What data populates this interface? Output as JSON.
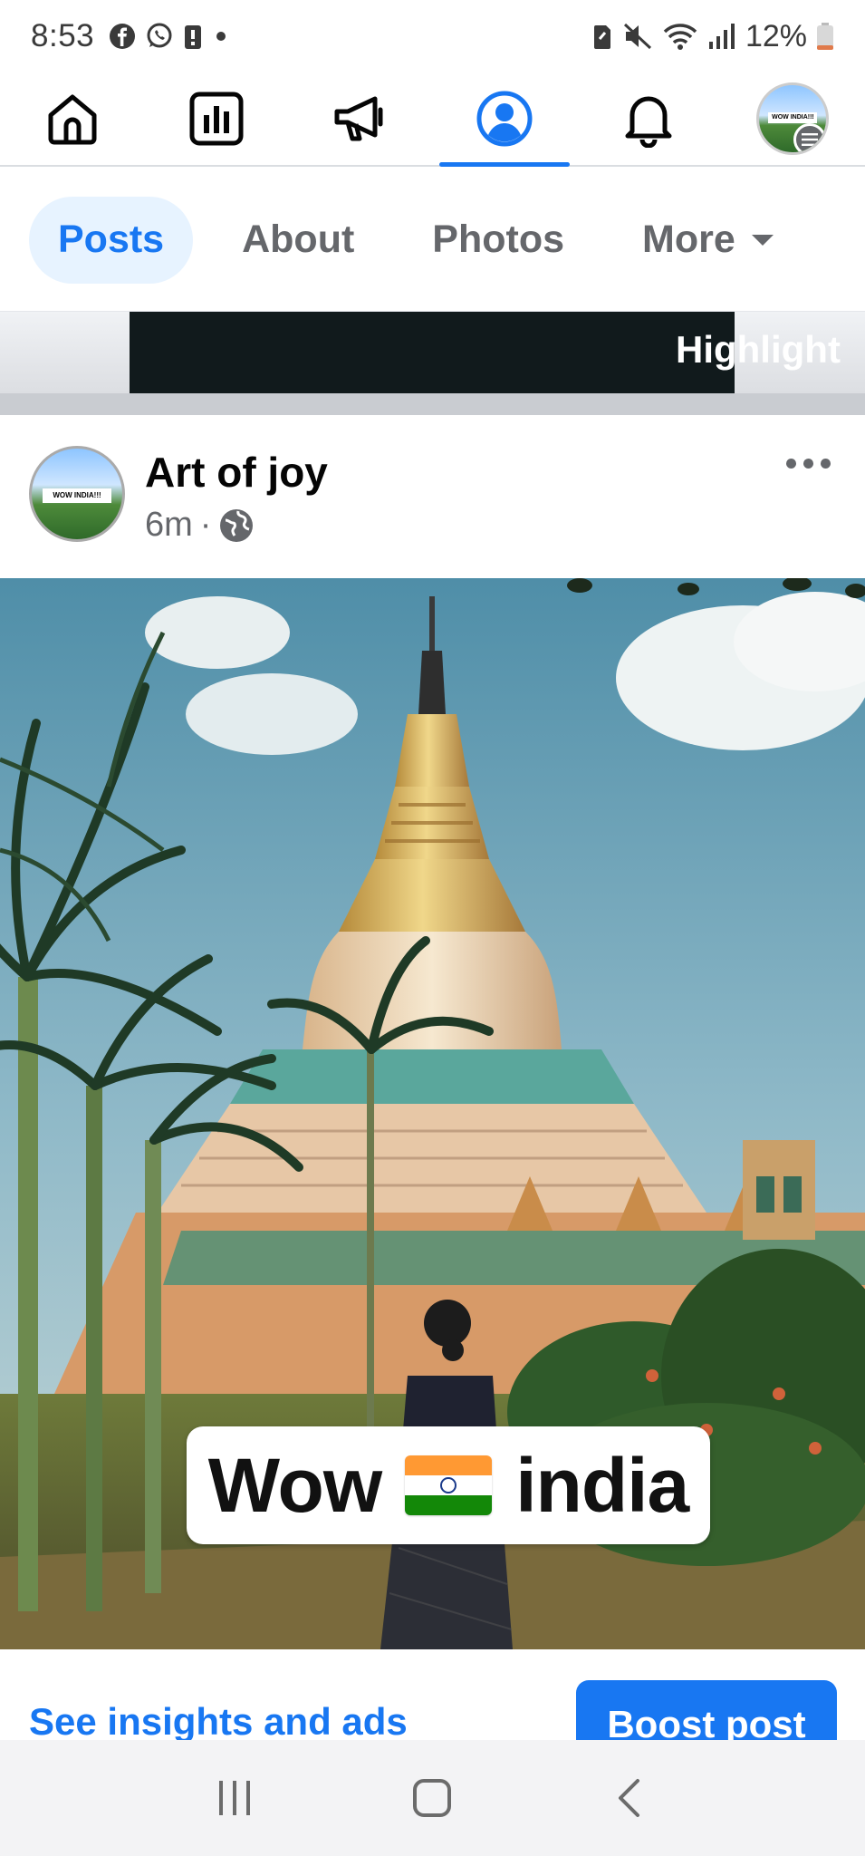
{
  "status_bar": {
    "time": "8:53",
    "battery": "12%",
    "icons": [
      "facebook-icon",
      "whatsapp-icon",
      "battery-saver-icon",
      "dot-icon",
      "sd-icon",
      "mute-icon",
      "wifi-icon",
      "signal-icon",
      "battery-icon"
    ]
  },
  "top_nav": {
    "items": [
      "home-icon",
      "dashboard-icon",
      "megaphone-icon",
      "profile-icon",
      "notifications-icon",
      "avatar-menu"
    ],
    "active": "profile-icon",
    "avatar_text": "WOW INDIA!!!"
  },
  "tabs": [
    {
      "label": "Posts"
    },
    {
      "label": "About"
    },
    {
      "label": "Photos"
    },
    {
      "label": "More"
    }
  ],
  "highlight_strip": {
    "label": "Highlight"
  },
  "post": {
    "author": "Art of joy",
    "time": "6m",
    "separator": "·",
    "avatar_text": "WOW INDIA!!!",
    "caption_left": "Wow",
    "caption_right": "india",
    "insights_link": "See insights and ads",
    "boost_label": "Boost post"
  },
  "colors": {
    "accent": "#1877f2",
    "tab_active_bg": "#e7f3ff",
    "muted_text": "#65676b"
  }
}
